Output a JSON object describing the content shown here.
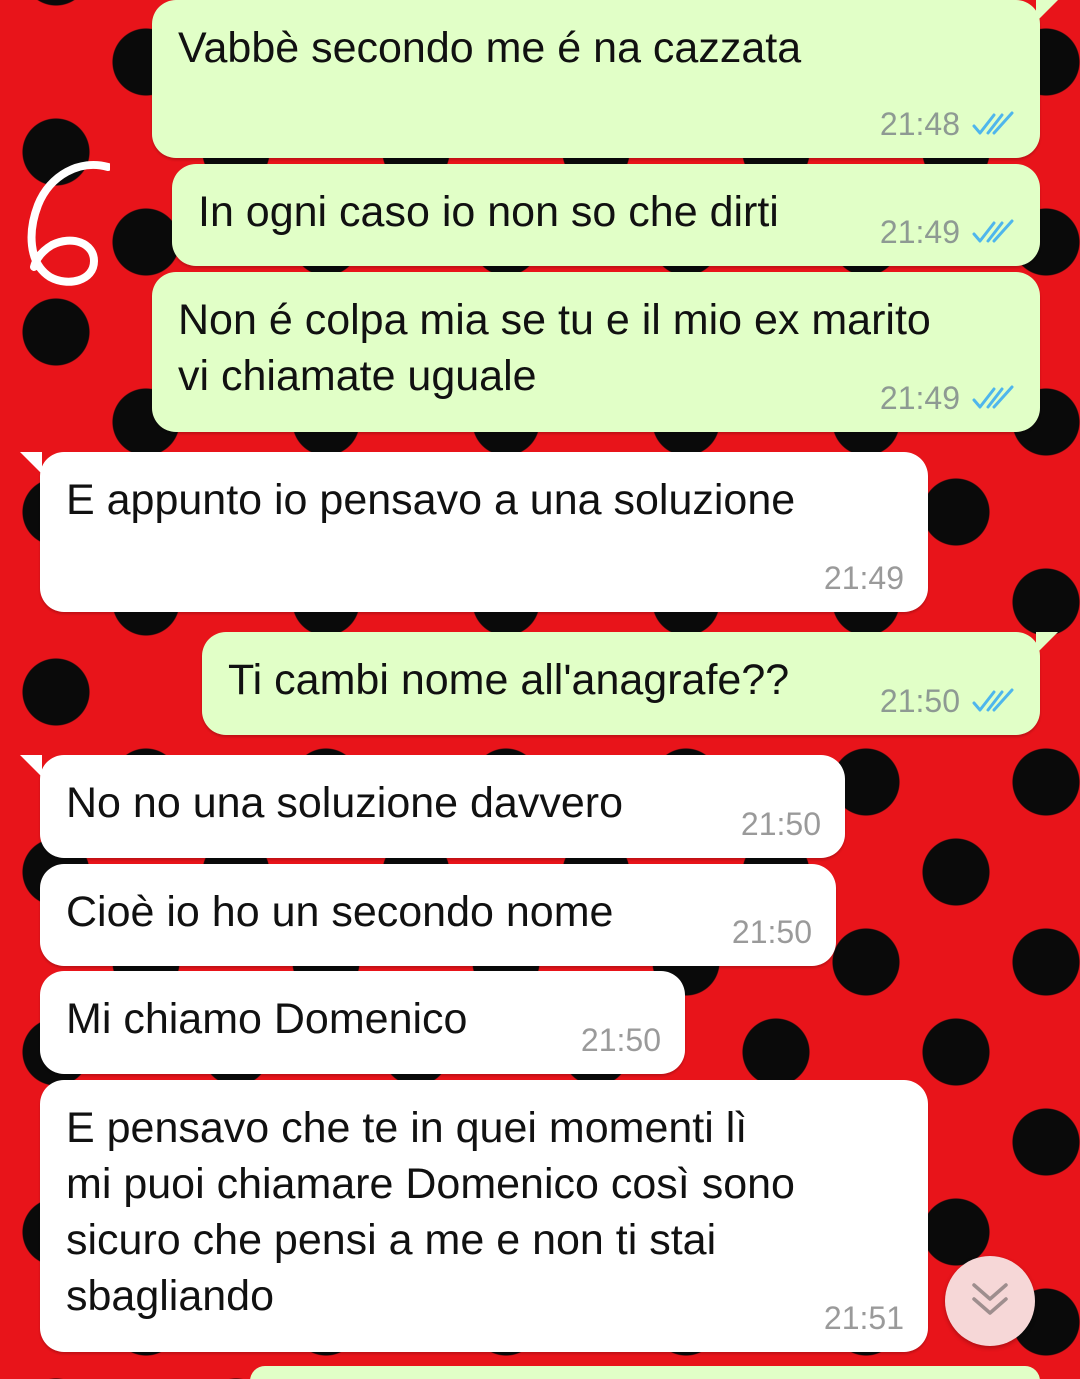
{
  "messages": [
    {
      "direction": "outgoing",
      "text": "Vabbè secondo me é na cazzata",
      "time": "21:48",
      "status": "read"
    },
    {
      "direction": "outgoing",
      "text": "In ogni caso io non so che dirti",
      "time": "21:49",
      "status": "read"
    },
    {
      "direction": "outgoing",
      "text": "Non é colpa mia se tu e il mio ex marito\nvi chiamate uguale",
      "time": "21:49",
      "status": "read"
    },
    {
      "direction": "incoming",
      "text": "E appunto io pensavo a una soluzione",
      "time": "21:49"
    },
    {
      "direction": "outgoing",
      "text": "Ti cambi nome all'anagrafe??",
      "time": "21:50",
      "status": "read"
    },
    {
      "direction": "incoming",
      "text": "No no una soluzione davvero",
      "time": "21:50"
    },
    {
      "direction": "incoming",
      "text": "Cioè io ho un secondo nome",
      "time": "21:50"
    },
    {
      "direction": "incoming",
      "text": "Mi chiamo Domenico",
      "time": "21:50"
    },
    {
      "direction": "incoming",
      "text": "E pensavo che te in quei momenti lì\nmi puoi chiamare Domenico così sono\nsicuro che pensi a me e non ti stai\nsbagliando",
      "time": "21:51"
    }
  ],
  "annotation": "6",
  "icons": {
    "read_receipt": "double-check-icon",
    "scroll_down": "chevron-double-down-icon"
  },
  "colors": {
    "outgoing_bubble": "#e1ffc7",
    "incoming_bubble": "#ffffff",
    "wallpaper_red": "#e8141a",
    "wallpaper_dots": "#0a0a0a",
    "read_tick_blue": "#4fb6ec",
    "timestamp_gray": "#8e9a93"
  }
}
